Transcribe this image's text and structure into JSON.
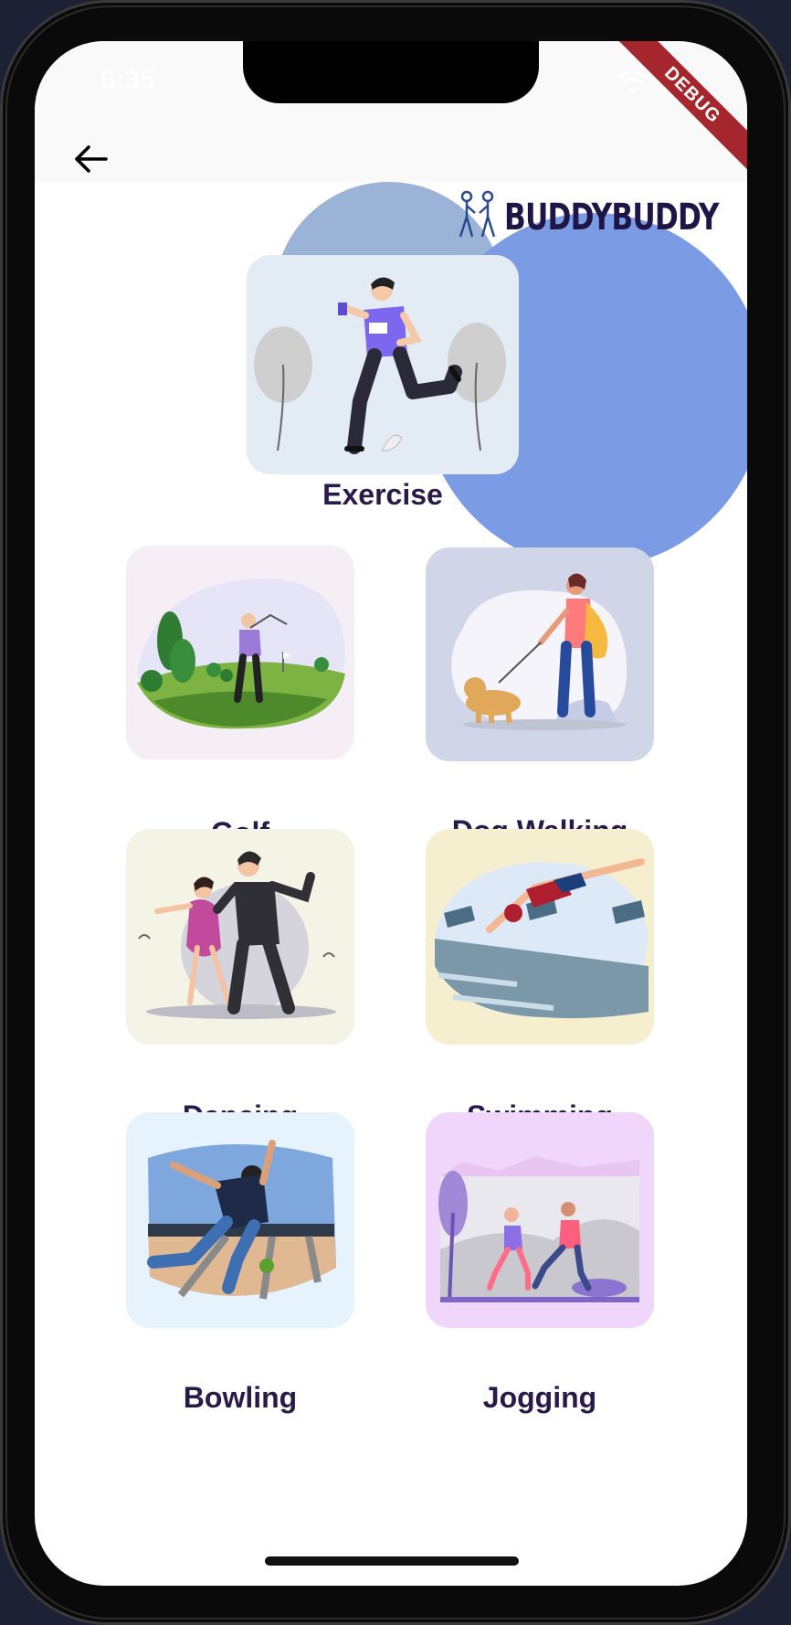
{
  "status_bar": {
    "time": "6:35"
  },
  "debug_banner": "DEBUG",
  "brand": {
    "name": "BUDDYBUDDY"
  },
  "featured": {
    "label": "Exercise"
  },
  "activities": [
    {
      "label": "Golf"
    },
    {
      "label": "Dog Walking"
    },
    {
      "label": "Dancing"
    },
    {
      "label": "Swimming"
    },
    {
      "label": "Bowling"
    },
    {
      "label": "Jogging"
    }
  ],
  "colors": {
    "blob_light": "#9cb3d8",
    "blob_dark": "#7b9ce5",
    "label_text": "#2a1a4a",
    "brand_text": "#1f1547",
    "debug_banner": "#a5262c"
  },
  "icons": {
    "back": "arrow-left-icon",
    "wifi": "wifi-icon",
    "battery": "battery-icon"
  }
}
